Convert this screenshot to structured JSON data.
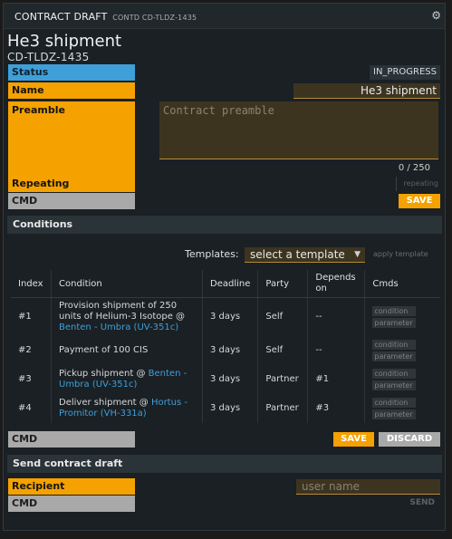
{
  "window": {
    "title": "CONTRACT DRAFT",
    "subtitle": "CONTD CD-TLDZ-1435",
    "icon": "gear-icon"
  },
  "header": {
    "title": "He3 shipment",
    "id": "CD-TLDZ-1435"
  },
  "form": {
    "status_label": "Status",
    "status_value": "IN_PROGRESS",
    "name_label": "Name",
    "name_value": "He3 shipment",
    "preamble_label": "Preamble",
    "preamble_placeholder": "Contract preamble",
    "preamble_counter": "0 / 250",
    "repeating_label": "Repeating",
    "repeating_value": "repeating",
    "cmd_label": "CMD",
    "save_label": "SAVE"
  },
  "conditions": {
    "heading": "Conditions",
    "templates_label": "Templates:",
    "template_selected": "select a template",
    "apply_label": "apply template",
    "columns": [
      "Index",
      "Condition",
      "Deadline",
      "Party",
      "Depends on",
      "Cmds"
    ],
    "rows": [
      {
        "index": "#1",
        "text": "Provision shipment of 250 units of Helium-3 Isotope @",
        "link": "Benten - Umbra (UV-351c)",
        "deadline": "3 days",
        "party": "Self",
        "depends": "--",
        "cmd1": "condition",
        "cmd2": "parameter"
      },
      {
        "index": "#2",
        "text": "Payment of 100 CIS",
        "link": "",
        "deadline": "3 days",
        "party": "Self",
        "depends": "--",
        "cmd1": "condition",
        "cmd2": "parameter"
      },
      {
        "index": "#3",
        "text": "Pickup shipment @",
        "link": "Benten - Umbra (UV-351c)",
        "deadline": "3 days",
        "party": "Partner",
        "depends": "#1",
        "cmd1": "condition",
        "cmd2": "parameter"
      },
      {
        "index": "#4",
        "text": "Deliver shipment @",
        "link": "Hortus - Promitor (VH-331a)",
        "deadline": "3 days",
        "party": "Partner",
        "depends": "#3",
        "cmd1": "condition",
        "cmd2": "parameter"
      }
    ],
    "cmd_label": "CMD",
    "save_label": "SAVE",
    "discard_label": "DISCARD"
  },
  "send": {
    "heading": "Send contract draft",
    "recipient_label": "Recipient",
    "recipient_placeholder": "user name",
    "cmd_label": "CMD",
    "send_label": "SEND"
  },
  "colors": {
    "accent_orange": "#f5a100",
    "accent_blue": "#3f9fd8",
    "background": "#1a2024"
  }
}
